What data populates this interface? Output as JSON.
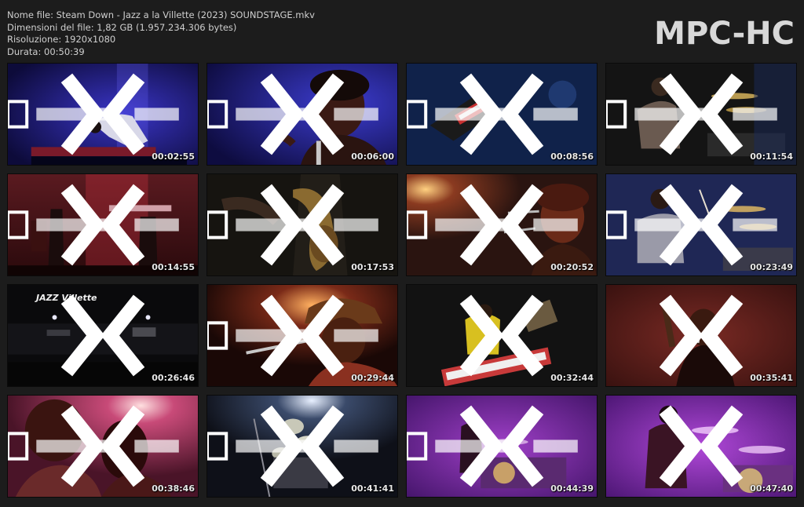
{
  "info": {
    "filename": "Nome file: Steam Down - Jazz a la Villette (2023) SOUNDSTAGE.mkv",
    "filesize": "Dimensioni del file: 1,82 GB (1.957.234.306 bytes)",
    "resolution": "Risoluzione: 1920x1080",
    "duration": "Durata: 00:50:39"
  },
  "brand": "MPC-HC",
  "thumbnails": [
    {
      "time": "00:02:55",
      "scene": "blue stage, performer bending over keyboard"
    },
    {
      "time": "00:06:00",
      "scene": "blue light, vocalist singing into microphone"
    },
    {
      "time": "00:08:56",
      "scene": "overhead view of synthesizer on stage"
    },
    {
      "time": "00:11:54",
      "scene": "drummer at drum kit"
    },
    {
      "time": "00:14:55",
      "scene": "red-lit wide shot of band on stage"
    },
    {
      "time": "00:17:53",
      "scene": "close-up of saxophone"
    },
    {
      "time": "00:20:52",
      "scene": "vocalist with dreadlocks at microphone"
    },
    {
      "time": "00:23:49",
      "scene": "drummer with sticks raised"
    },
    {
      "time": "00:26:46",
      "scene": "dark wide shot of stage with banner",
      "banner": "JAZZ Villette"
    },
    {
      "time": "00:29:44",
      "scene": "singer in bucket hat with microphone"
    },
    {
      "time": "00:32:44",
      "scene": "keyboardist in yellow shirt at red keyboard"
    },
    {
      "time": "00:35:41",
      "scene": "singer with raised arm"
    },
    {
      "time": "00:38:46",
      "scene": "pink-lit close-up of performers"
    },
    {
      "time": "00:41:41",
      "scene": "drum kit cymbals under white light"
    },
    {
      "time": "00:44:39",
      "scene": "purple-lit drummer wide shot"
    },
    {
      "time": "00:47:40",
      "scene": "purple-lit drummer close shot"
    }
  ],
  "colors": {
    "background": "#1c1c1c",
    "text": "#cfcfcf",
    "brand": "#d8d8d8"
  }
}
